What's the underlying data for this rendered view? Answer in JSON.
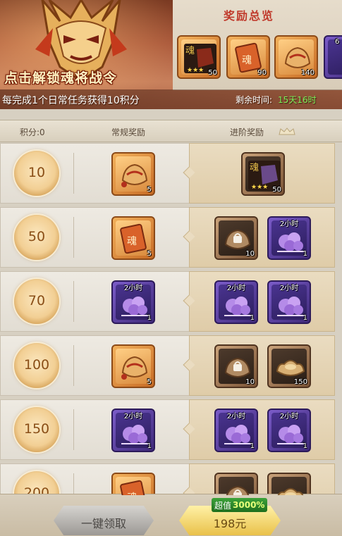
{
  "banner": {
    "title": "点击解锁魂将战令",
    "description": "每完成1个日常任务获得10积分",
    "remaining_label": "剩余时间:",
    "remaining_value": "15天16时",
    "overview_title": "奖励总览",
    "preview_items": [
      {
        "icon": "hero-card-icon",
        "qty": "50",
        "frame": "orange"
      },
      {
        "icon": "soul-token-icon",
        "qty": "90",
        "frame": "orange"
      },
      {
        "icon": "ingot-bag-icon",
        "qty": "140",
        "frame": "orange"
      },
      {
        "icon": "partial-item-icon",
        "qty": "6",
        "frame": "purple"
      }
    ]
  },
  "columns": {
    "points": "积分:0",
    "normal": "常规奖励",
    "advanced": "进阶奖励"
  },
  "rows": [
    {
      "points": "10",
      "normal": [
        {
          "frame": "orange",
          "icon": "ingot-bag-icon",
          "qty": "5",
          "tag": ""
        }
      ],
      "advanced": [
        {
          "frame": "brown",
          "icon": "hero-card-icon",
          "qty": "50",
          "tag": ""
        }
      ]
    },
    {
      "points": "50",
      "normal": [
        {
          "frame": "orange",
          "icon": "soul-token-icon",
          "qty": "5",
          "tag": ""
        }
      ],
      "advanced": [
        {
          "frame": "brown",
          "icon": "locked-box-icon",
          "qty": "10",
          "tag": ""
        },
        {
          "frame": "purple",
          "icon": "speed-up-icon",
          "qty": "1",
          "tag": "2小时"
        }
      ]
    },
    {
      "points": "70",
      "normal": [
        {
          "frame": "purple",
          "icon": "speed-up-icon",
          "qty": "1",
          "tag": "2小时"
        }
      ],
      "advanced": [
        {
          "frame": "purple",
          "icon": "speed-up-icon",
          "qty": "1",
          "tag": "2小时"
        },
        {
          "frame": "purple",
          "icon": "speed-up-icon",
          "qty": "1",
          "tag": "2小时"
        }
      ]
    },
    {
      "points": "100",
      "normal": [
        {
          "frame": "orange",
          "icon": "ingot-bag-icon",
          "qty": "5",
          "tag": ""
        }
      ],
      "advanced": [
        {
          "frame": "brown",
          "icon": "locked-box-icon",
          "qty": "10",
          "tag": ""
        },
        {
          "frame": "brown",
          "icon": "gold-ingot-icon",
          "qty": "150",
          "tag": ""
        }
      ]
    },
    {
      "points": "150",
      "normal": [
        {
          "frame": "purple",
          "icon": "speed-up-icon",
          "qty": "1",
          "tag": "2小时"
        }
      ],
      "advanced": [
        {
          "frame": "purple",
          "icon": "speed-up-icon",
          "qty": "1",
          "tag": "2小时"
        },
        {
          "frame": "purple",
          "icon": "speed-up-icon",
          "qty": "1",
          "tag": "2小时"
        }
      ]
    },
    {
      "points": "200",
      "normal": [
        {
          "frame": "orange",
          "icon": "soul-token-icon",
          "qty": "",
          "tag": ""
        }
      ],
      "advanced": [
        {
          "frame": "brown",
          "icon": "locked-box-icon",
          "qty": "",
          "tag": ""
        },
        {
          "frame": "brown",
          "icon": "gold-ingot-icon",
          "qty": "",
          "tag": ""
        }
      ]
    }
  ],
  "footer": {
    "claim_all": "一键领取",
    "buy_price": "198元",
    "value_prefix": "超值",
    "value_percent": "3000%"
  },
  "colors": {
    "accent_red": "#c0392b",
    "timer_green": "#7cf05a",
    "gold_button": "#e9c14a"
  }
}
